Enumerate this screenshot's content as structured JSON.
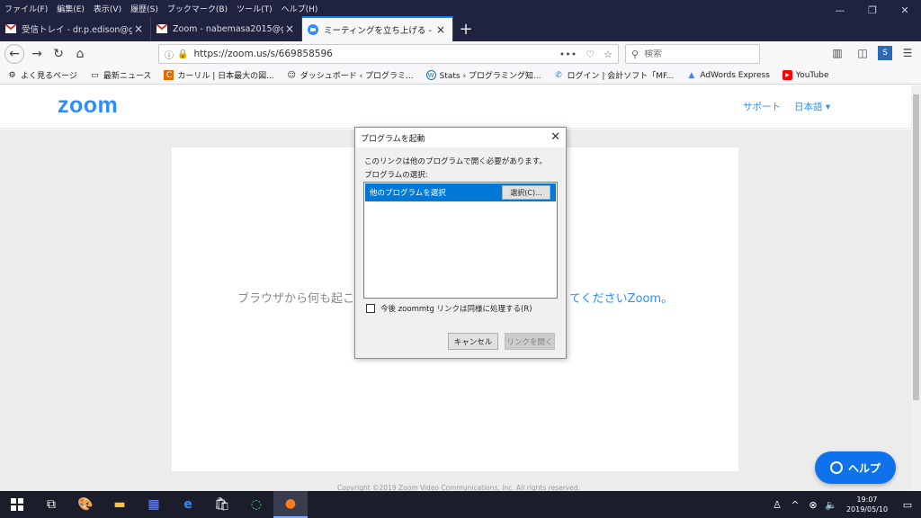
{
  "menubar": {
    "items": [
      "ファイル(F)",
      "編集(E)",
      "表示(V)",
      "履歴(S)",
      "ブックマーク(B)",
      "ツール(T)",
      "ヘルプ(H)"
    ]
  },
  "tabs": [
    {
      "label": "受信トレイ - dr.p.edison@gmail.",
      "icon": "gmail-icon"
    },
    {
      "label": "Zoom - nabemasa2015@gmail.",
      "icon": "gmail-icon"
    },
    {
      "label": "ミーティングを立ち上げる - Zoom",
      "icon": "zoom-icon"
    }
  ],
  "navbar": {
    "url": "https://zoom.us/s/669858596",
    "search_placeholder": "検索"
  },
  "bookmarks": [
    {
      "label": "よく見るページ",
      "icon": "gear-icon"
    },
    {
      "label": "最新ニュース",
      "icon": "folder-icon"
    },
    {
      "label": "カーリル | 日本最大の図...",
      "icon": "calil-icon"
    },
    {
      "label": "ダッシュボード ‹ プログラミ...",
      "icon": "avatar-icon"
    },
    {
      "label": "Stats ‹ プログラミング知...",
      "icon": "wordpress-icon"
    },
    {
      "label": "ログイン | 会計ソフト「MF...",
      "icon": "mf-icon"
    },
    {
      "label": "AdWords Express",
      "icon": "adwords-icon"
    },
    {
      "label": "YouTube",
      "icon": "youtube-icon"
    }
  ],
  "zoompage": {
    "logo": "zoom",
    "support": "サポート",
    "language": "日本語 ▾",
    "message_left": "ブラウザから何も起こ",
    "message_right": "てくださいZoom。",
    "copyright": "Copyright ©2019 Zoom Video Communications, Inc. All rights reserved.",
    "help_button": "ヘルプ"
  },
  "dialog": {
    "title": "プログラムを起動",
    "text1": "このリンクは他のプログラムで開く必要があります。",
    "text2": "プログラムの選択:",
    "selected_item": "他のプログラムを選択",
    "choose_button": "選択(C)...",
    "checkbox_label": "今後 zoommtg リンクは同様に処理する(R)",
    "cancel_button": "キャンセル",
    "open_button": "リンクを開く"
  },
  "taskbar": {
    "time": "19:07",
    "date": "2019/05/10"
  },
  "colors": {
    "chrome": "#202340",
    "zoom_blue": "#2d8cff",
    "selection": "#0078d7",
    "help": "#0e72ed"
  }
}
